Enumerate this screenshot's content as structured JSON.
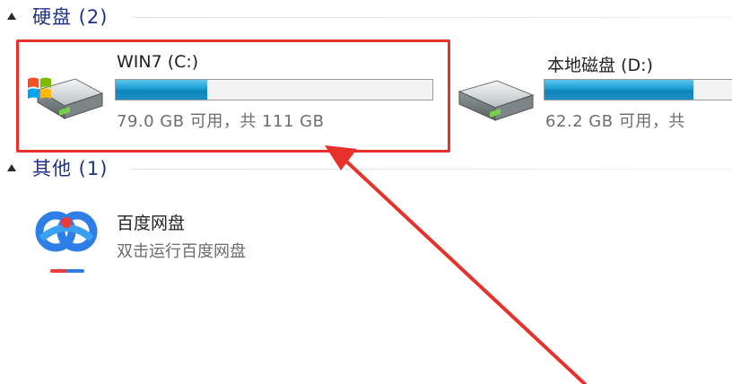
{
  "sections": {
    "drives": {
      "title": "硬盘 (2)"
    },
    "other": {
      "title": "其他 (1)"
    }
  },
  "drives": [
    {
      "name": "WIN7 (C:)",
      "free_text": "79.0 GB 可用，共 111 GB",
      "used_fraction": 0.289
    },
    {
      "name": "本地磁盘 (D:)",
      "free_text": "62.2 GB 可用，共",
      "used_fraction": 0.76
    }
  ],
  "apps": [
    {
      "name": "百度网盘",
      "description": "双击运行百度网盘",
      "icon": "baidu-netdisk-icon"
    }
  ],
  "colors": {
    "section_title": "#1e3287",
    "highlight": "#e8312b",
    "bar_fill": "#1b9ed7"
  }
}
